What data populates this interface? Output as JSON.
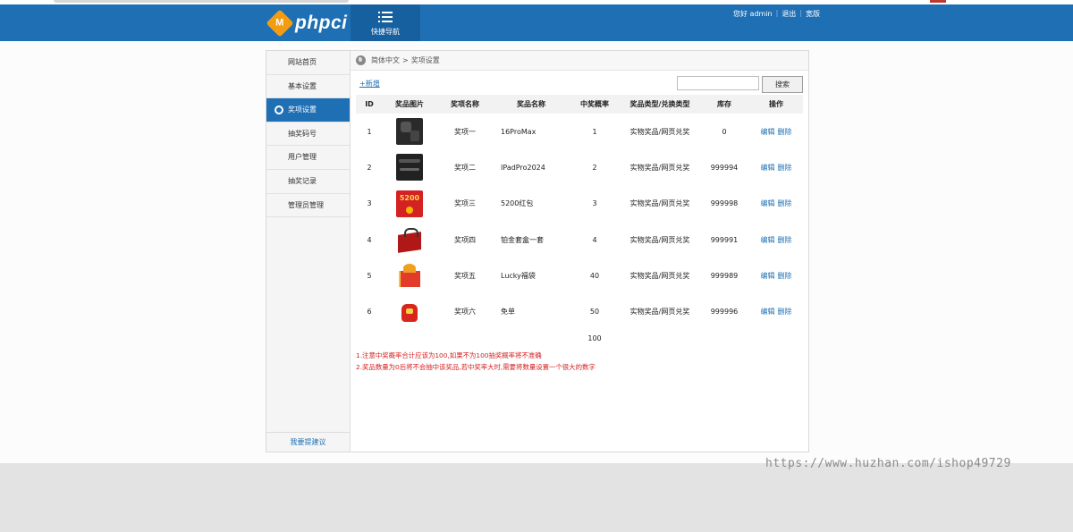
{
  "header": {
    "logo_mark": "M",
    "logo_text": "phpci",
    "quick_nav_label": "快捷导航",
    "user_greeting": "您好 admin",
    "logout": "退出",
    "widescreen": "宽版"
  },
  "sidebar": {
    "items": [
      {
        "label": "网站首页"
      },
      {
        "label": "基本设置"
      },
      {
        "label": "奖项设置"
      },
      {
        "label": "抽奖码号"
      },
      {
        "label": "用户管理"
      },
      {
        "label": "抽奖记录"
      },
      {
        "label": "管理员管理"
      }
    ],
    "footer": "我要提建议"
  },
  "breadcrumb": {
    "root": "简体中文",
    "separator": ">",
    "current": "奖项设置"
  },
  "toolbar": {
    "add_label": "+新增",
    "search_value": "",
    "search_button": "搜索"
  },
  "table": {
    "headers": [
      "ID",
      "奖品图片",
      "奖项名称",
      "奖品名称",
      "中奖概率",
      "奖品类型/兑换类型",
      "库存",
      "操作"
    ],
    "rows": [
      {
        "id": "1",
        "image": "phone",
        "prize_level": "奖项一",
        "prize_name": "16ProMax",
        "probability": "1",
        "type": "实物奖品/网页兑奖",
        "stock": "0",
        "edit": "编辑",
        "delete": "删除"
      },
      {
        "id": "2",
        "image": "tablet",
        "prize_level": "奖项二",
        "prize_name": "IPadPro2024",
        "probability": "2",
        "type": "实物奖品/网页兑奖",
        "stock": "999994",
        "edit": "编辑",
        "delete": "删除"
      },
      {
        "id": "3",
        "image": "red-envelope",
        "image_text": "5200",
        "prize_level": "奖项三",
        "prize_name": "5200红包",
        "probability": "3",
        "type": "实物奖品/网页兑奖",
        "stock": "999998",
        "edit": "编辑",
        "delete": "删除"
      },
      {
        "id": "4",
        "image": "gift-box",
        "prize_level": "奖项四",
        "prize_name": "铂金套盒一套",
        "probability": "4",
        "type": "实物奖品/网页兑奖",
        "stock": "999991",
        "edit": "编辑",
        "delete": "删除"
      },
      {
        "id": "5",
        "image": "gift-pile",
        "prize_level": "奖项五",
        "prize_name": "Lucky福袋",
        "probability": "40",
        "type": "实物奖品/网页兑奖",
        "stock": "999989",
        "edit": "编辑",
        "delete": "删除"
      },
      {
        "id": "6",
        "image": "lucky-bag",
        "prize_level": "奖项六",
        "prize_name": "免单",
        "probability": "50",
        "type": "实物奖品/网页兑奖",
        "stock": "999996",
        "edit": "编辑",
        "delete": "删除"
      }
    ],
    "probability_total": "100"
  },
  "notes": [
    "1.注意中奖概率合计应该为100,如果不为100抽奖概率将不准确",
    "2.奖品数量为0后将不会抽中该奖品,若中奖率大时,需要将数量设置一个很大的数字"
  ],
  "watermark": "https://www.huzhan.com/ishop49729",
  "colors": {
    "primary": "#1e6fb4",
    "accent": "#f39c12",
    "warning_text": "#d42121"
  }
}
